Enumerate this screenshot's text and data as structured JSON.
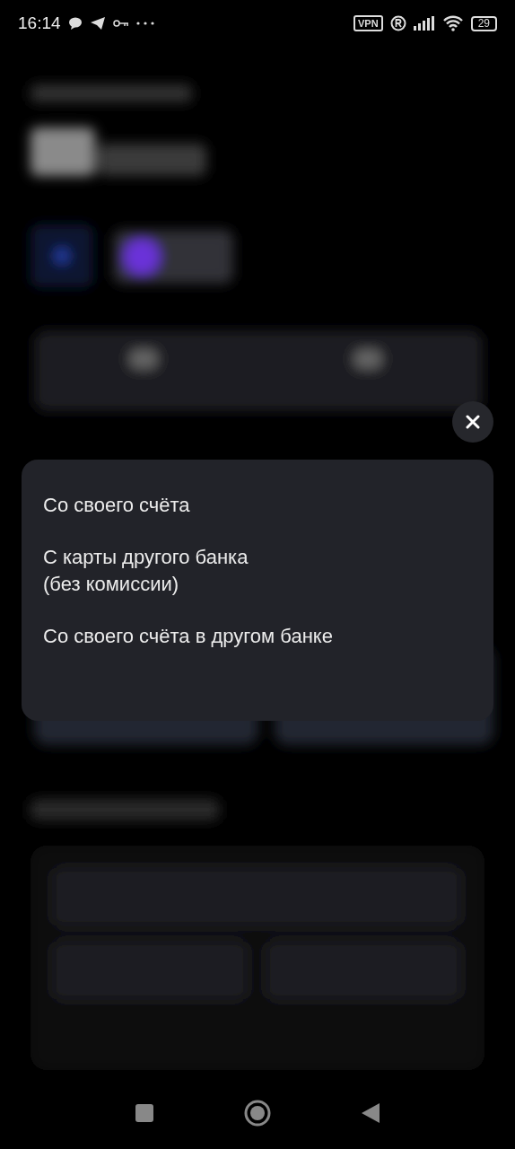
{
  "status_bar": {
    "time": "16:14",
    "vpn": "VPN",
    "battery": "29"
  },
  "menu": {
    "items": [
      {
        "label": "Со своего счёта"
      },
      {
        "label": "С карты другого банка\n(без комиссии)"
      },
      {
        "label": "Со своего счёта в другом банке"
      }
    ]
  }
}
